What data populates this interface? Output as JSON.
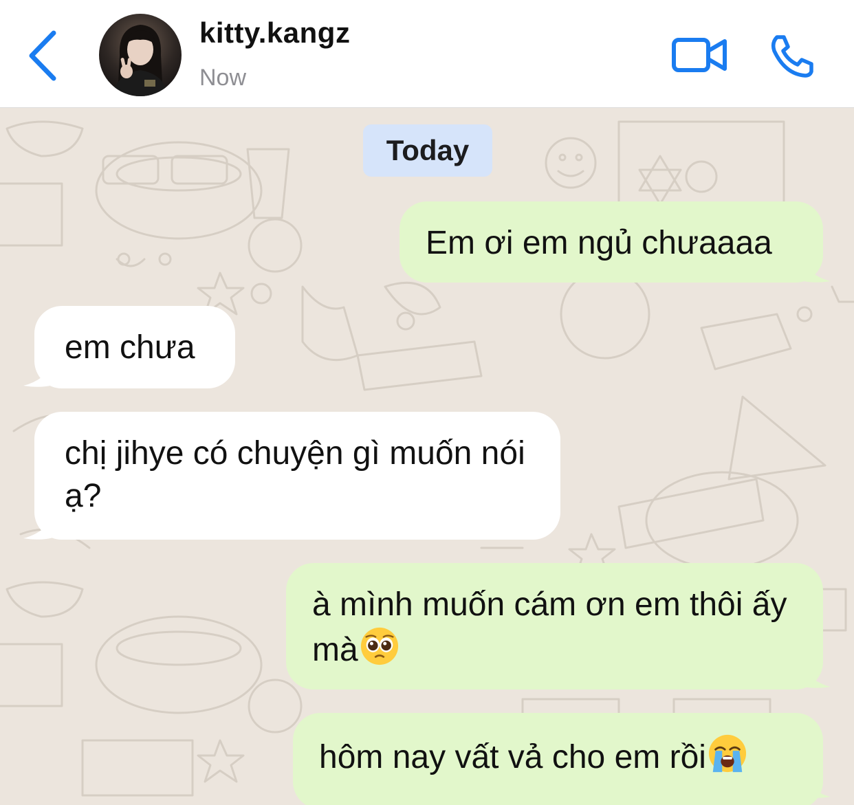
{
  "header": {
    "contact_name": "kitty.kangz",
    "status": "Now",
    "back_icon": "chevron-left-icon",
    "video_icon": "video-camera-icon",
    "call_icon": "phone-icon",
    "accent_color": "#1a7cf0"
  },
  "chat": {
    "date_label": "Today",
    "messages": [
      {
        "direction": "outgoing",
        "text": "Em ơi em ngủ chưaaaa"
      },
      {
        "direction": "incoming",
        "text": "em chưa"
      },
      {
        "direction": "incoming",
        "text": "chị jihye có chuyện gì muốn nói ạ?"
      },
      {
        "direction": "outgoing",
        "text": "à mình muốn cám ơn em thôi ấy mà",
        "emoji": "pleading-face-emoji"
      },
      {
        "direction": "outgoing",
        "text": "hôm nay vất vả cho em rồi",
        "emoji": "loudly-crying-face-emoji"
      }
    ],
    "colors": {
      "outgoing_bubble": "#e2f7cb",
      "incoming_bubble": "#ffffff",
      "date_pill": "#d6e4fa",
      "wallpaper": "#ece5dd"
    }
  }
}
